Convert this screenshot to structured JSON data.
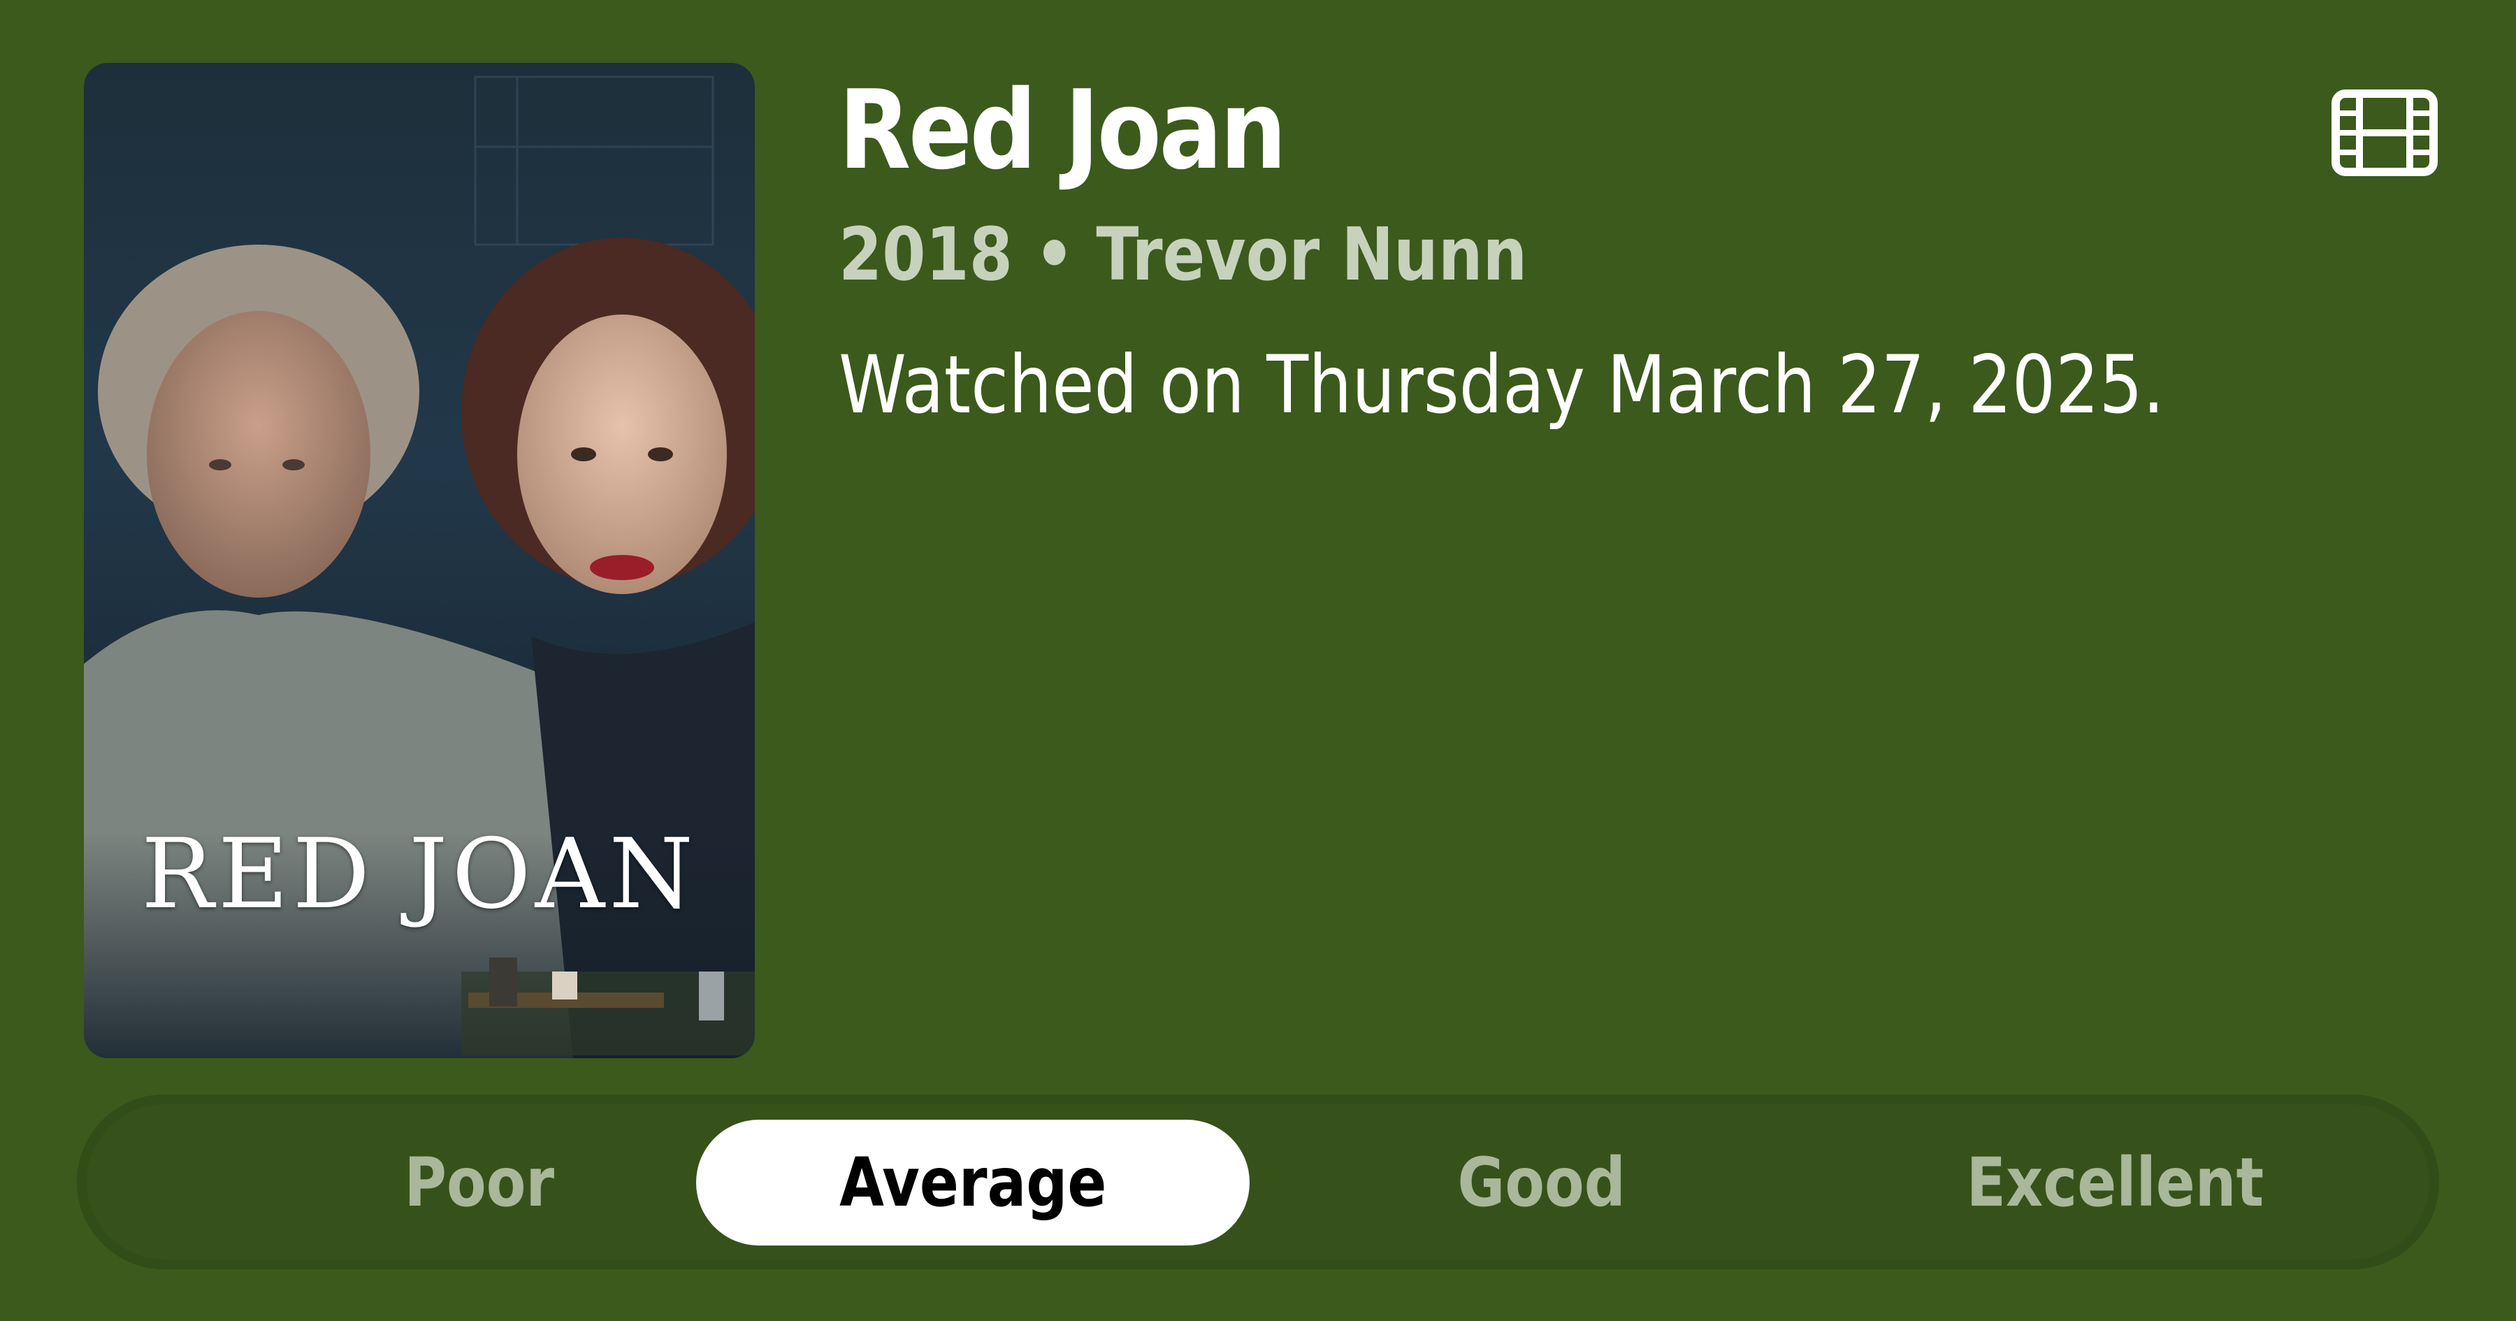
{
  "movie": {
    "title": "Red Joan",
    "meta": "2018 • Trevor Nunn",
    "watched": "Watched on Thursday March 27, 2025.",
    "poster_title": "RED JOAN"
  },
  "icons": {
    "type_icon": "film-icon"
  },
  "rating": {
    "options": [
      "Poor",
      "Average",
      "Good",
      "Excellent"
    ],
    "selected": "Average"
  },
  "colors": {
    "background": "#3b5a1c",
    "selected_segment": "#ffffff",
    "unselected_text": "#a9b89a"
  }
}
